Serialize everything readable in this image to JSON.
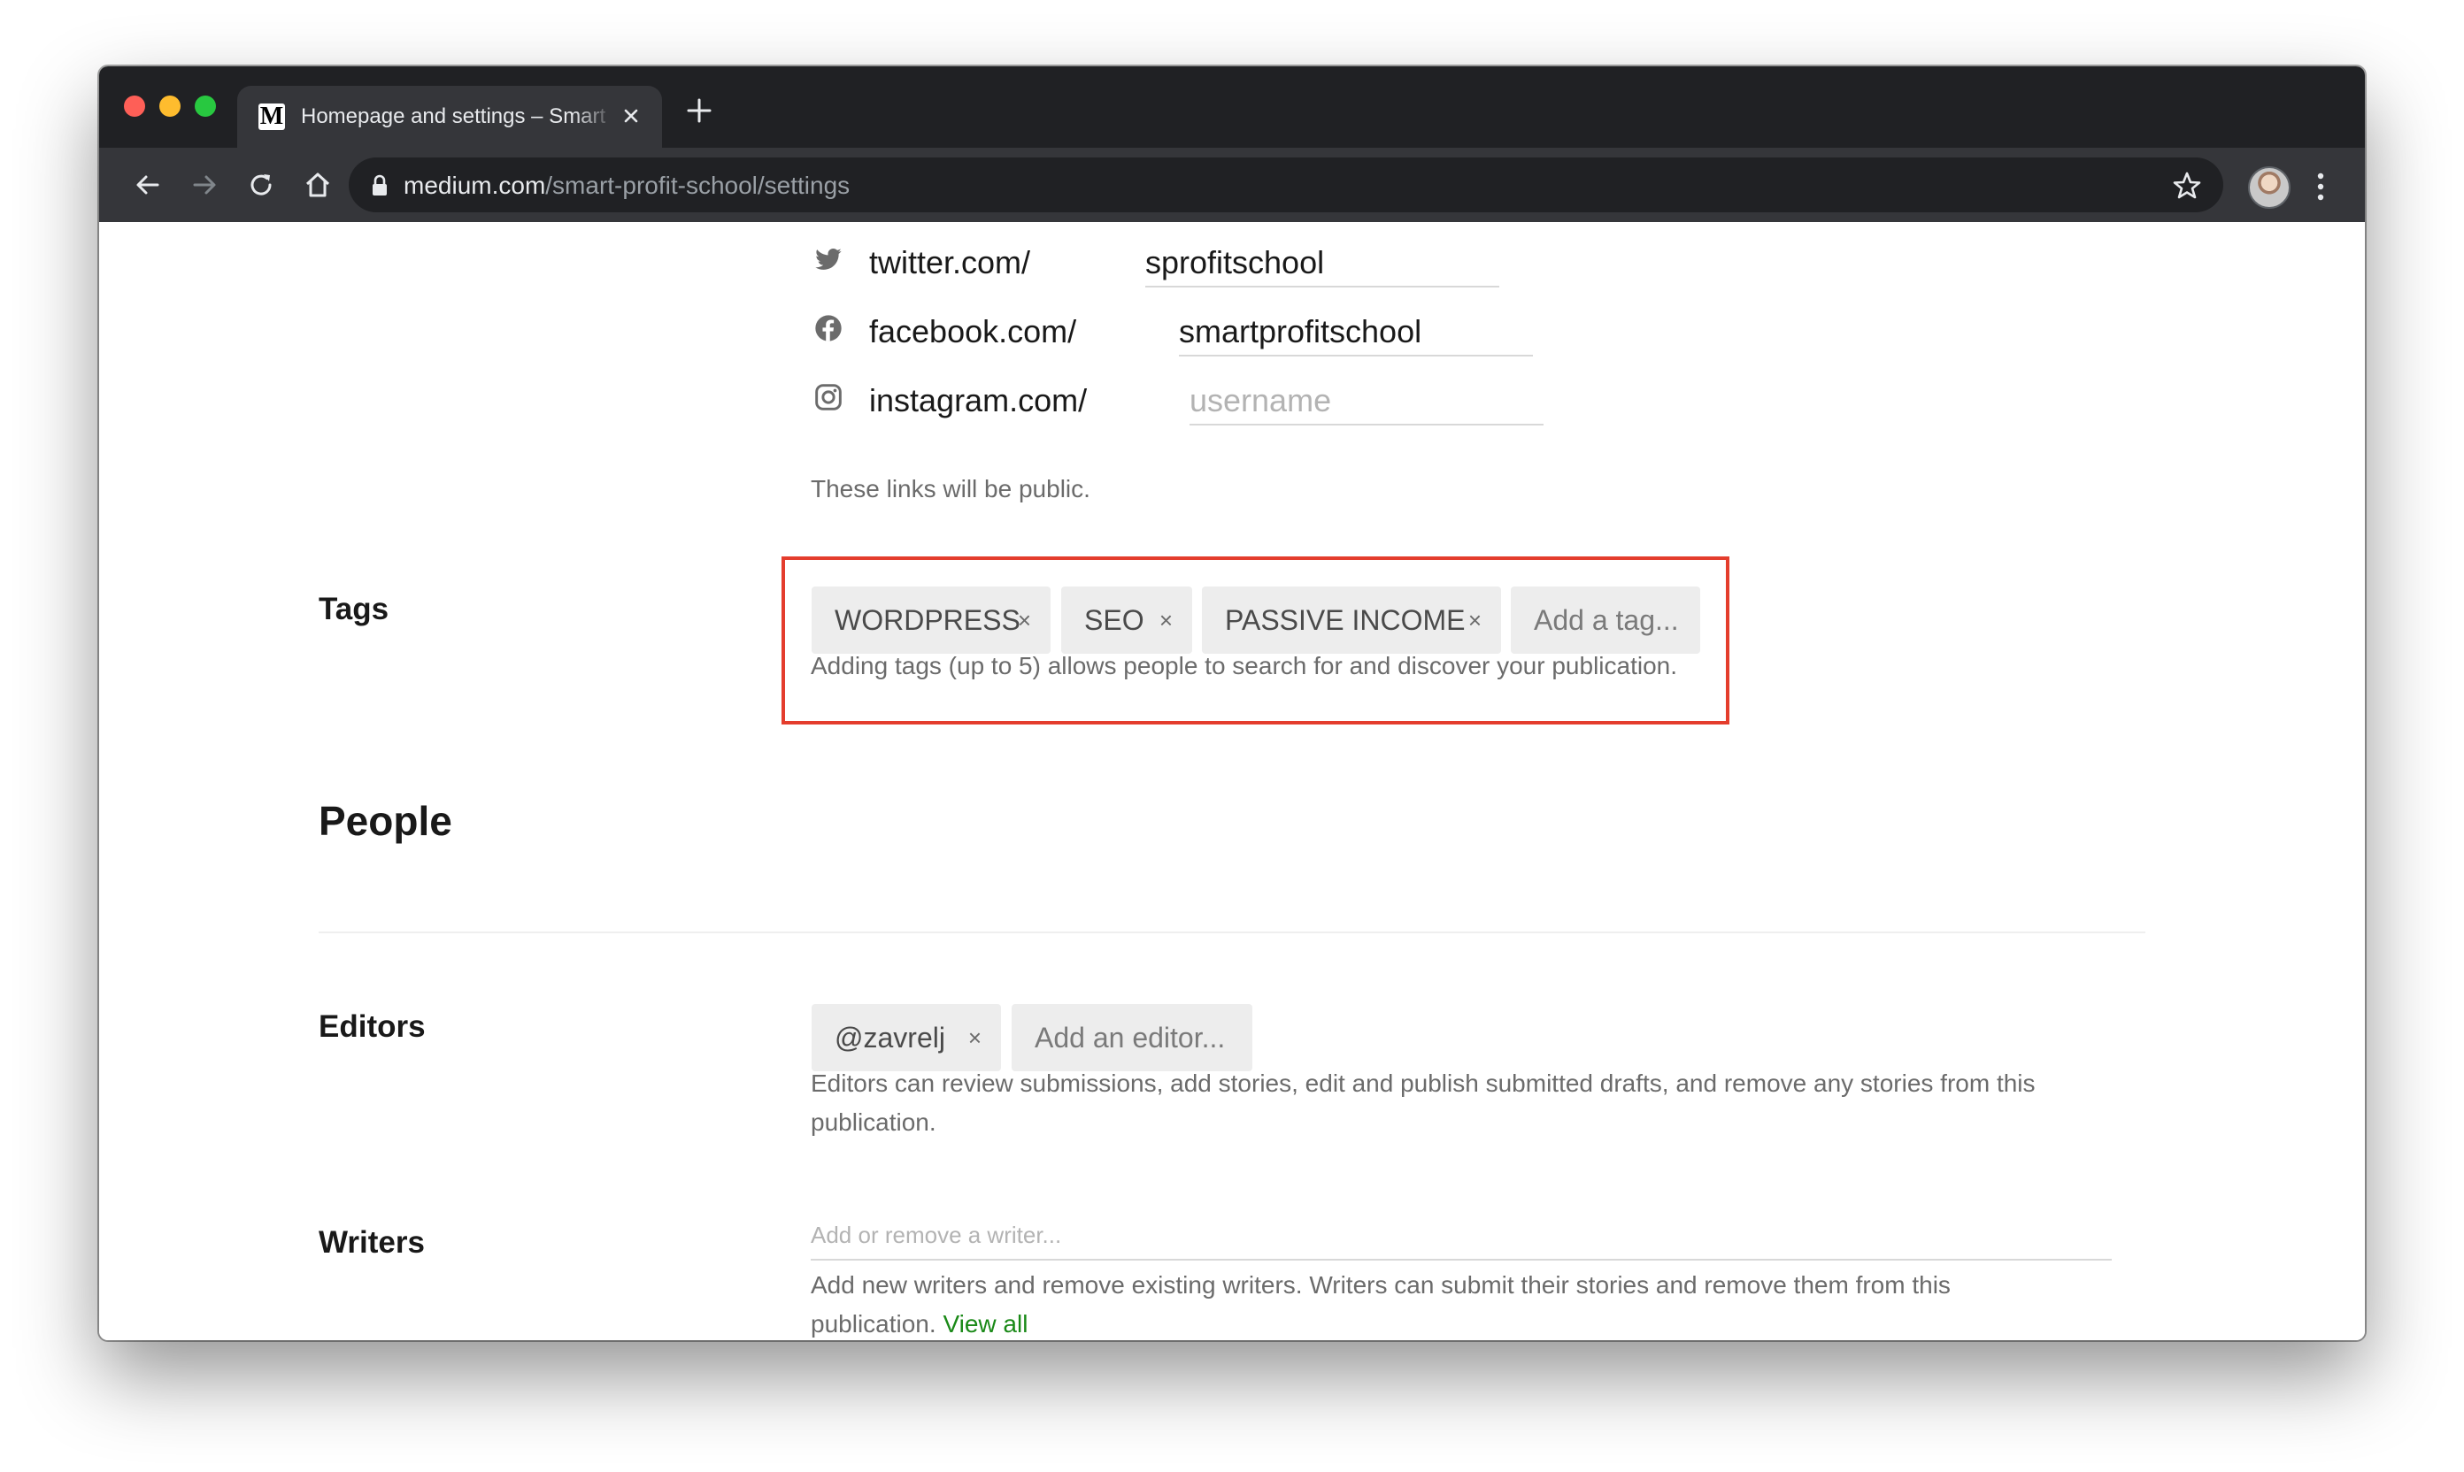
{
  "browser": {
    "tab_title": "Homepage and settings – Smart Profit School",
    "favicon_letter": "M",
    "url_host": "medium.com",
    "url_path": "/smart-profit-school/settings"
  },
  "social": {
    "twitter": {
      "prefix": "twitter.com/",
      "value": "sprofitschool"
    },
    "facebook": {
      "prefix": "facebook.com/",
      "value": "smartprofitschool"
    },
    "instagram": {
      "prefix": "instagram.com/",
      "value": "",
      "placeholder": "username"
    },
    "help": "These links will be public."
  },
  "tags": {
    "label": "Tags",
    "items": [
      "WORDPRESS",
      "SEO",
      "PASSIVE INCOME"
    ],
    "remove_symbol": "×",
    "add_placeholder": "Add a tag...",
    "help": "Adding tags (up to 5) allows people to search for and discover your publication.",
    "highlight_color": "#e43d2d"
  },
  "people": {
    "title": "People",
    "editors": {
      "label": "Editors",
      "items": [
        "@zavrelj"
      ],
      "add_placeholder": "Add an editor...",
      "help_line1": "Editors can review submissions, add stories, edit and publish submitted drafts, and remove any stories from this",
      "help_line2": "publication."
    },
    "writers": {
      "label": "Writers",
      "placeholder": "Add or remove a writer...",
      "help_line1": "Add new writers and remove existing writers. Writers can submit their stories and remove them from this",
      "help_line2": "publication.",
      "view_all": "View all"
    }
  },
  "colors": {
    "link_green": "#1a8917",
    "chrome_dark": "#202124",
    "chrome_toolbar": "#35363a"
  }
}
